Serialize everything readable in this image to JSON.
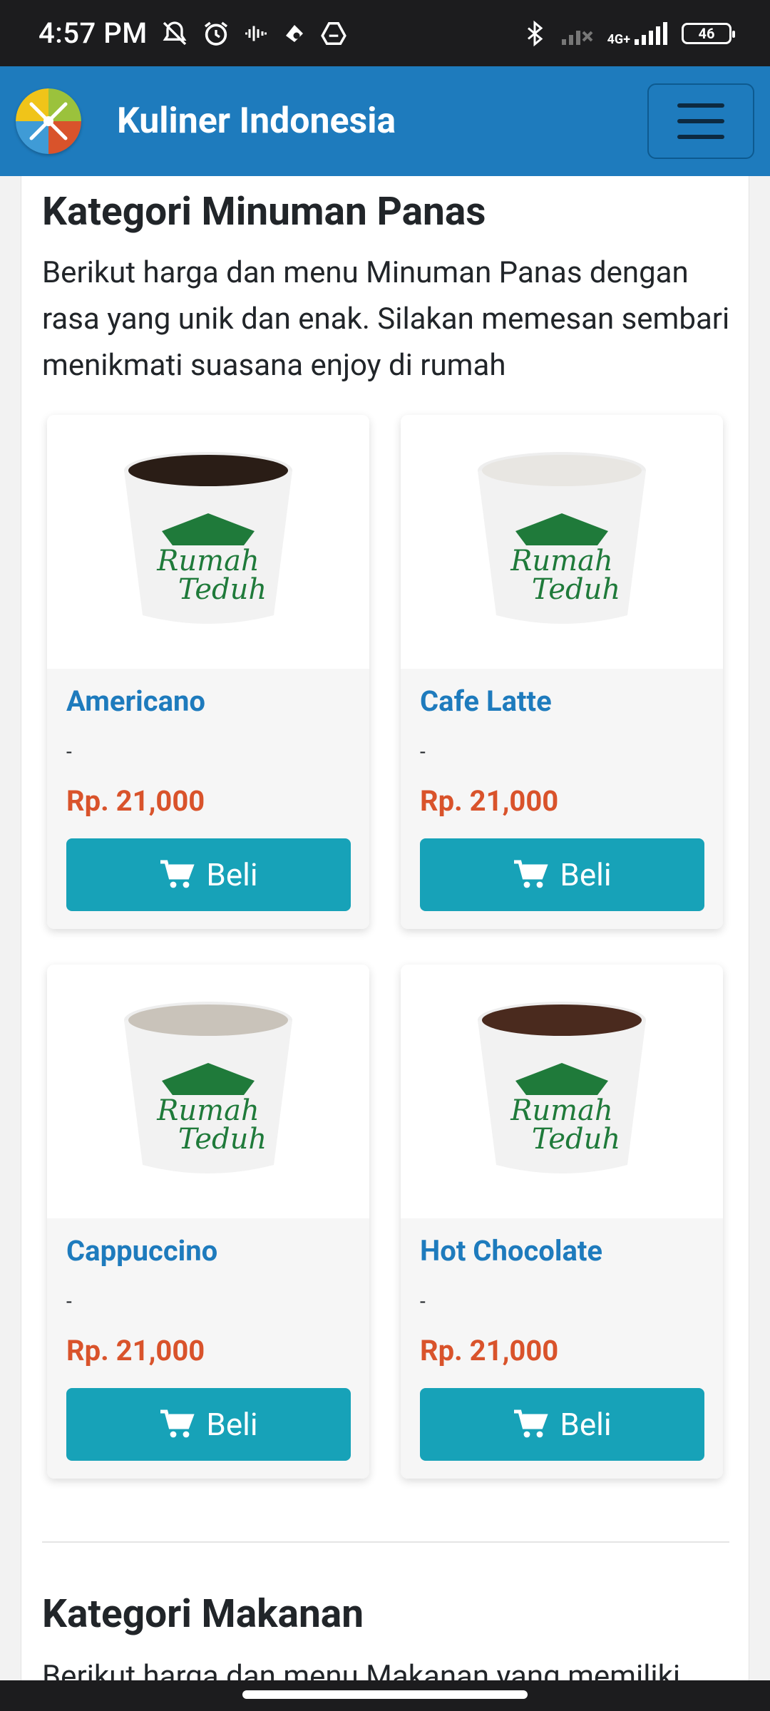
{
  "status_bar": {
    "time": "4:57 PM",
    "network": "4G+",
    "battery": "46",
    "icons": [
      "notifications-off-icon",
      "alarm-icon",
      "vibrate-icon",
      "app-icon",
      "drive-icon",
      "bluetooth-icon",
      "signal-off-icon",
      "signal-icon",
      "battery-icon"
    ]
  },
  "app_bar": {
    "title": "Kuliner Indonesia",
    "logo_icon": "restaurant-logo-icon",
    "menu_icon": "hamburger-menu-icon",
    "bg_color": "#1e7bbd"
  },
  "section_hot_drinks": {
    "title": "Kategori Minuman Panas",
    "description": "Berikut harga dan menu Minuman Panas dengan rasa yang unik dan enak. Silakan memesan sembari menikmati suasana enjoy di rumah"
  },
  "products": [
    {
      "name": "Americano",
      "description": "-",
      "price": "Rp. 21,000",
      "button": "Beli",
      "drink_color": "#2a1d16"
    },
    {
      "name": "Cafe Latte",
      "description": "-",
      "price": "Rp. 21,000",
      "button": "Beli",
      "drink_color": "#e8e6e2"
    },
    {
      "name": "Cappuccino",
      "description": "-",
      "price": "Rp. 21,000",
      "button": "Beli",
      "drink_color": "#c9c3ba"
    },
    {
      "name": "Hot Chocolate",
      "description": "-",
      "price": "Rp. 21,000",
      "button": "Beli",
      "drink_color": "#4a2a1e"
    }
  ],
  "cup_brand": {
    "line1": "Rumah",
    "line2": "Teduh"
  },
  "section_food": {
    "title": "Kategori Makanan",
    "description": "Berikut harga dan menu Makanan yang memiliki"
  },
  "colors": {
    "accent": "#1e7bbd",
    "price": "#d9532b",
    "button": "#17a2b8"
  }
}
